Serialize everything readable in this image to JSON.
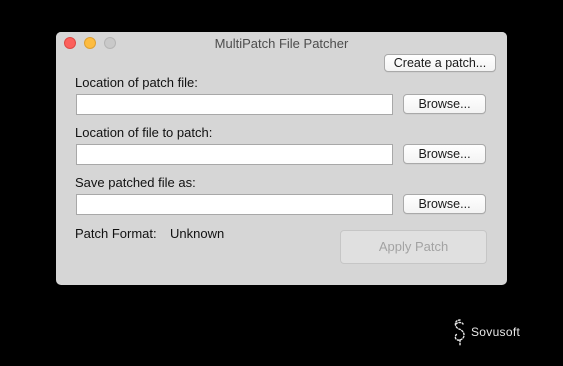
{
  "window": {
    "title": "MultiPatch File Patcher"
  },
  "toolbar": {
    "create_patch_label": "Create a patch..."
  },
  "fields": {
    "patch_file": {
      "label": "Location of patch file:",
      "value": "",
      "browse_label": "Browse..."
    },
    "file_to_patch": {
      "label": "Location of file to patch:",
      "value": "",
      "browse_label": "Browse..."
    },
    "save_as": {
      "label": "Save patched file as:",
      "value": "",
      "browse_label": "Browse..."
    }
  },
  "status": {
    "patch_format_label": "Patch Format:",
    "patch_format_value": "Unknown"
  },
  "actions": {
    "apply_label": "Apply Patch",
    "apply_enabled": false
  },
  "watermark": {
    "text": "Sovusoft"
  },
  "colors": {
    "close": "#fc605c",
    "minimize": "#fdbc40",
    "zoom_inactive": "#c9c9c9",
    "window_bg": "#d6d6d6",
    "desktop_bg": "#000000"
  }
}
